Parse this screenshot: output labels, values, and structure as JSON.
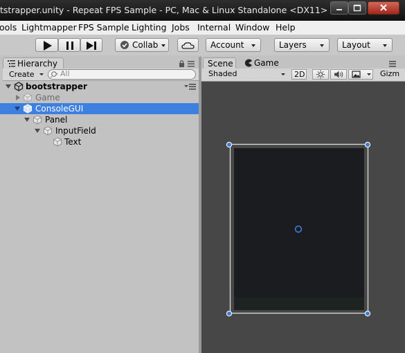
{
  "window": {
    "title": "tstrapper.unity - Repeat FPS Sample - PC, Mac & Linux Standalone <DX11>"
  },
  "menu": [
    "ools",
    "Lightmapper",
    "FPS Sample",
    "Lighting",
    "Jobs",
    "Internal",
    "Window",
    "Help"
  ],
  "toolbar": {
    "collab": "Collab",
    "account": "Account",
    "layers": "Layers",
    "layout": "Layout"
  },
  "hierarchy": {
    "tab": "Hierarchy",
    "create": "Create",
    "search_placeholder": "All",
    "items": [
      {
        "label": "bootstrapper",
        "bold": true
      },
      {
        "label": "Game"
      },
      {
        "label": "ConsoleGUI",
        "selected": true
      },
      {
        "label": "Panel"
      },
      {
        "label": "InputField"
      },
      {
        "label": "Text"
      }
    ]
  },
  "scene": {
    "tab_scene": "Scene",
    "tab_game": "Game",
    "shading": "Shaded",
    "mode_2d": "2D",
    "gizmos": "Gizm"
  },
  "colors": {
    "selection": "#3d80df",
    "handle": "#3a7cd9",
    "canvas": "#1b1c20"
  }
}
